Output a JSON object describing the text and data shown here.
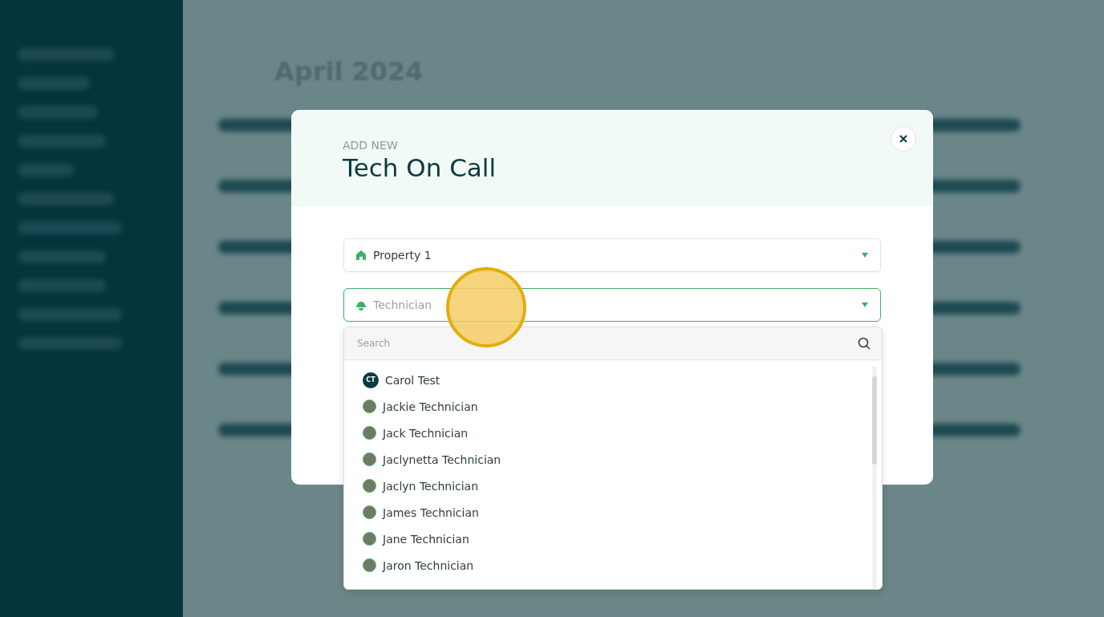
{
  "calendar": {
    "title": "April 2024"
  },
  "modal": {
    "eyebrow": "ADD NEW",
    "title": "Tech On Call",
    "property_select": {
      "value": "Property 1"
    },
    "technician_select": {
      "placeholder": "Technician",
      "expanded": true
    },
    "dropdown": {
      "search": {
        "placeholder": "Search"
      },
      "options": [
        {
          "name": "Carol Test",
          "kind": "initials",
          "initials": "CT"
        },
        {
          "name": "Jackie Technician",
          "kind": "photo"
        },
        {
          "name": "Jack Technician",
          "kind": "photo"
        },
        {
          "name": "Jaclynetta Technician",
          "kind": "photo"
        },
        {
          "name": "Jaclyn Technician",
          "kind": "photo"
        },
        {
          "name": "James Technician",
          "kind": "photo"
        },
        {
          "name": "Jane Technician",
          "kind": "photo"
        },
        {
          "name": "Jaron Technician",
          "kind": "photo"
        }
      ]
    }
  }
}
